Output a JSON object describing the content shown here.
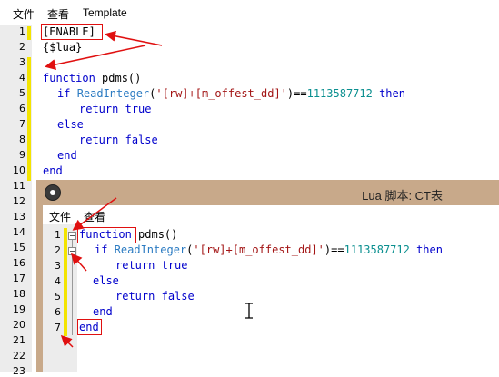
{
  "menubar": {
    "file": "文件",
    "view": "查看",
    "template": "Template"
  },
  "editor": {
    "line_numbers": [
      "1",
      "2",
      "3",
      "4",
      "5",
      "6",
      "7",
      "8",
      "9",
      "10",
      "11",
      "12",
      "13",
      "14",
      "15",
      "16",
      "17",
      "18",
      "19",
      "20",
      "21",
      "22",
      "23"
    ],
    "lines": {
      "l1": "[ENABLE]",
      "l2": "{$lua}",
      "l4_kw": "function",
      "l4_rest": " pdms()",
      "l5_kw": "if",
      "l5_fn": "ReadInteger",
      "l5_paren_open": "(",
      "l5_str": "'[rw]+[m_offest_dd]'",
      "l5_eq": ")==",
      "l5_num": "1113587712",
      "l5_then": "then",
      "l6_kw": "return",
      "l6_val": "true",
      "l7_kw": "else",
      "l8_kw": "return",
      "l8_val": "false",
      "l9_kw": "end",
      "l10_kw": "end"
    }
  },
  "subwindow": {
    "title": "Lua 脚本: CT表",
    "menu": {
      "file": "文件",
      "view": "查看"
    },
    "line_numbers": [
      "1",
      "2",
      "3",
      "4",
      "5",
      "6",
      "7"
    ],
    "lines": {
      "l1_kw": "function",
      "l1_rest": " pdms()",
      "l2_kw": "if",
      "l2_fn": "ReadInteger",
      "l2_paren_open": "(",
      "l2_str": "'[rw]+[m_offest_dd]'",
      "l2_eq": ")==",
      "l2_num": "1113587712",
      "l2_then": "then",
      "l3_kw": "return",
      "l3_val": "true",
      "l4_kw": "else",
      "l5_kw": "return",
      "l5_val": "false",
      "l6_kw": "end",
      "l7_kw": "end"
    }
  },
  "colors": {
    "keyword": "#0000cc",
    "function": "#2b7bc2",
    "string": "#a31515",
    "number": "#0a8f8f",
    "annotation": "#e01010",
    "change_bar": "#f3e400",
    "subwindow_frame": "#c8a98a"
  },
  "icons": {
    "subwindow_icon": "gear-icon",
    "cursor": "text-cursor-icon"
  }
}
